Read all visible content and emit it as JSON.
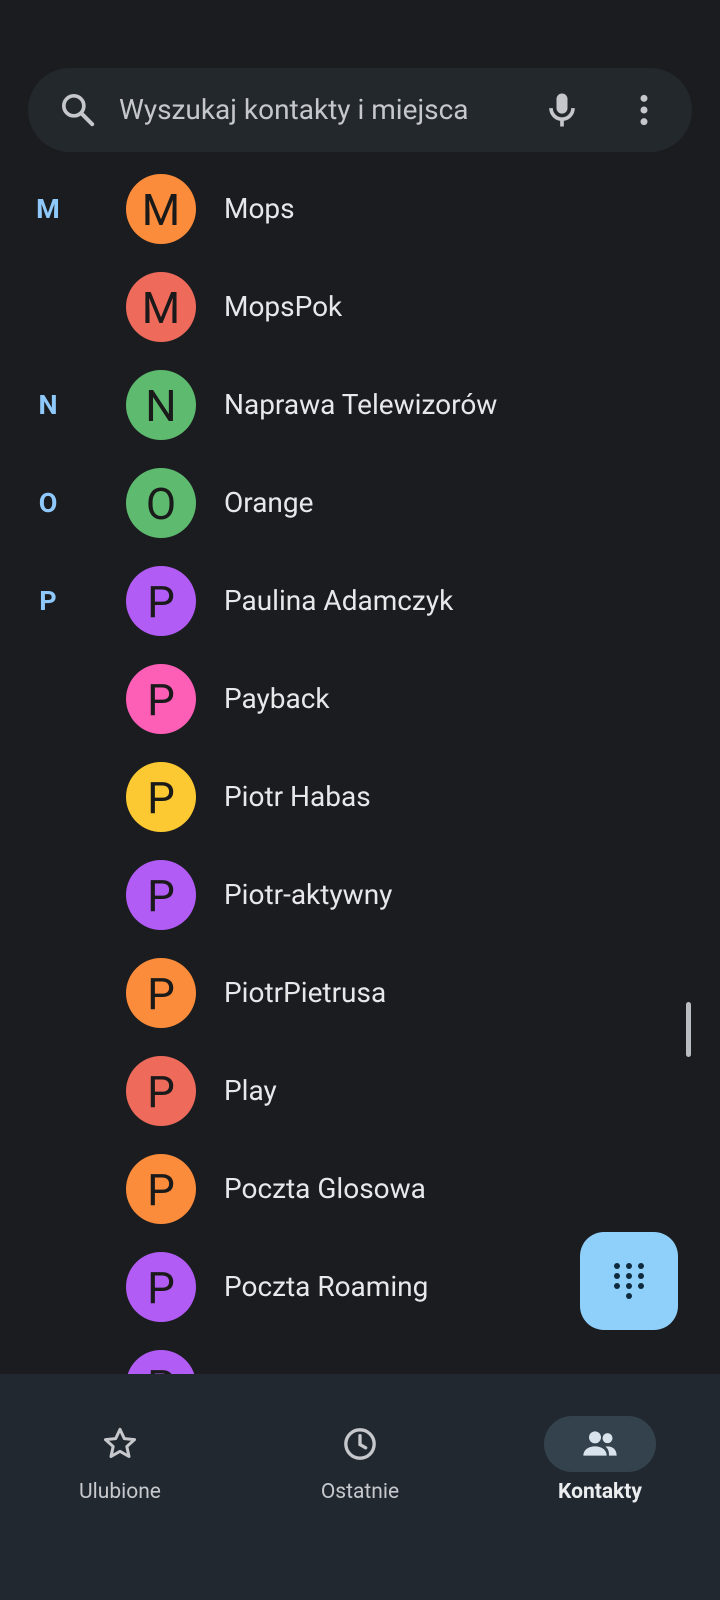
{
  "search": {
    "placeholder": "Wyszukaj kontakty i miejsca",
    "icons": [
      "search-icon",
      "mic-icon",
      "more-vert-icon"
    ]
  },
  "contacts": [
    {
      "section": "M",
      "initial": "M",
      "name": "Mops",
      "color": "#fb8c3c"
    },
    {
      "section": "",
      "initial": "M",
      "name": "MopsPok",
      "color": "#ee6b5c"
    },
    {
      "section": "N",
      "initial": "N",
      "name": "Naprawa Telewizorów",
      "color": "#5dba6e"
    },
    {
      "section": "O",
      "initial": "O",
      "name": "Orange",
      "color": "#5dba6e"
    },
    {
      "section": "P",
      "initial": "P",
      "name": "Paulina Adamczyk",
      "color": "#b15cf5"
    },
    {
      "section": "",
      "initial": "P",
      "name": "Payback",
      "color": "#fd5fb7"
    },
    {
      "section": "",
      "initial": "P",
      "name": "Piotr Habas",
      "color": "#fdc932"
    },
    {
      "section": "",
      "initial": "P",
      "name": "Piotr-aktywny",
      "color": "#b15cf5"
    },
    {
      "section": "",
      "initial": "P",
      "name": "PiotrPietrusa",
      "color": "#fb8c3c"
    },
    {
      "section": "",
      "initial": "P",
      "name": "Play",
      "color": "#ee6b5c"
    },
    {
      "section": "",
      "initial": "P",
      "name": "Poczta Glosowa",
      "color": "#fb8c3c"
    },
    {
      "section": "",
      "initial": "P",
      "name": "Poczta Roaming",
      "color": "#b15cf5"
    },
    {
      "section": "",
      "initial": "P",
      "name": "",
      "color": "#b15cf5"
    }
  ],
  "fab": {
    "icon": "dialpad-icon"
  },
  "nav": {
    "items": [
      {
        "label": "Ulubione",
        "icon": "star-icon",
        "active": false
      },
      {
        "label": "Ostatnie",
        "icon": "clock-icon",
        "active": false
      },
      {
        "label": "Kontakty",
        "icon": "people-icon",
        "active": true
      }
    ]
  },
  "colors": {
    "background": "#1b1c1f",
    "accent": "#8fd0fb",
    "section_letter": "#8fc9fb"
  }
}
